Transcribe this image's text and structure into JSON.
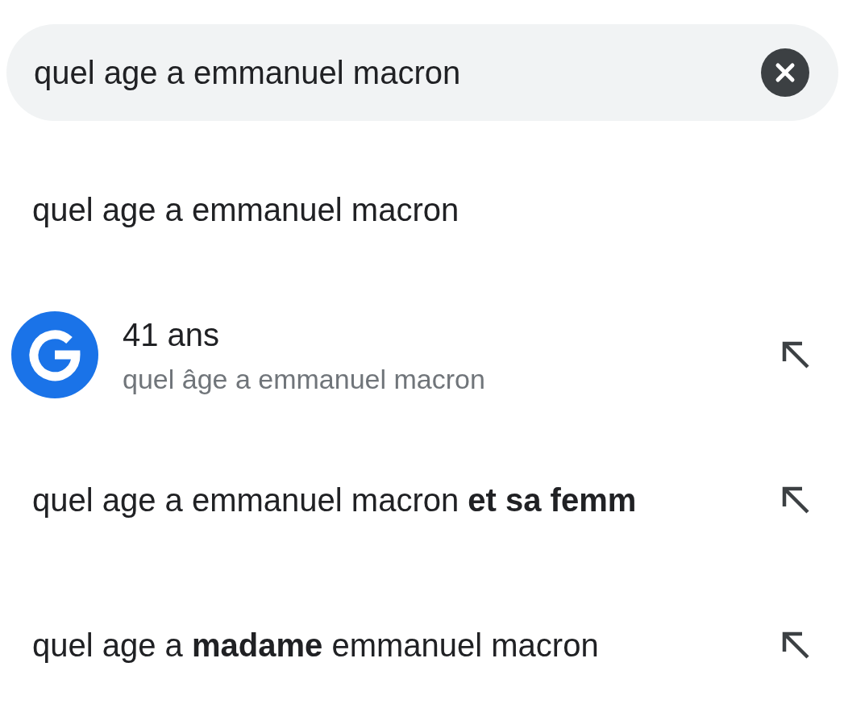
{
  "search": {
    "value": "quel age a emmanuel macron"
  },
  "suggestions": [
    {
      "kind": "typed",
      "text": "quel age a emmanuel macron"
    },
    {
      "kind": "answer",
      "text": "41 ans",
      "subtitle": "quel âge a emmanuel macron"
    },
    {
      "kind": "query",
      "text": "quel age a emmanuel macron **et sa femm**"
    },
    {
      "kind": "query",
      "text": "quel age a **madame** emmanuel macron"
    }
  ]
}
